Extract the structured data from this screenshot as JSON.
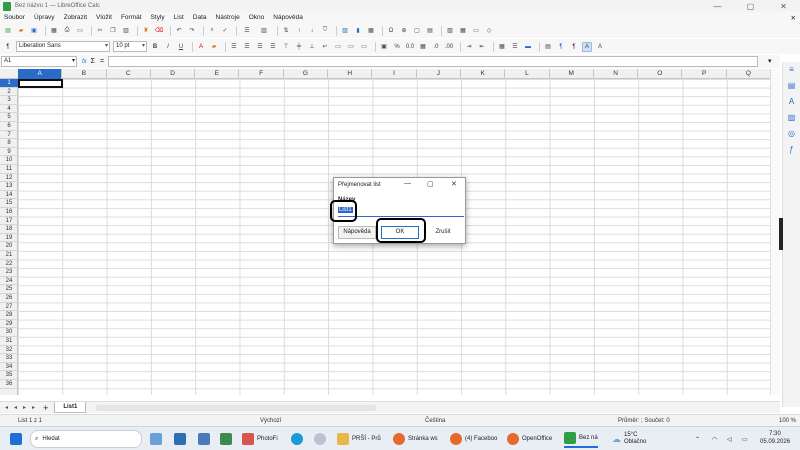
{
  "window": {
    "title": "Bez názvu 1 — LibreOffice Calc",
    "minimize": "—",
    "maximize": "▢",
    "close": "✕"
  },
  "menu": [
    "Soubor",
    "Úpravy",
    "Zobrazit",
    "Vložit",
    "Formát",
    "Styly",
    "List",
    "Data",
    "Nástroje",
    "Okno",
    "Nápověda"
  ],
  "menu_close": "✕",
  "toolbar2": {
    "font_name": "Liberation Sans",
    "font_size": "10 pt",
    "bold": "B",
    "italic": "I",
    "underline": "U",
    "percent": "%",
    "decimal": "0.0"
  },
  "formula_bar": {
    "name_box": "A1",
    "fx": "fx",
    "sigma": "Σ",
    "equals": "="
  },
  "columns": [
    "A",
    "B",
    "C",
    "D",
    "E",
    "F",
    "G",
    "H",
    "I",
    "J",
    "K",
    "L",
    "M",
    "N",
    "O",
    "P",
    "Q"
  ],
  "rows": [
    "1",
    "2",
    "3",
    "4",
    "5",
    "6",
    "7",
    "8",
    "9",
    "10",
    "11",
    "12",
    "13",
    "14",
    "15",
    "16",
    "17",
    "18",
    "19",
    "20",
    "21",
    "22",
    "23",
    "24",
    "25",
    "26",
    "27",
    "28",
    "29",
    "30",
    "31",
    "32",
    "33",
    "34",
    "35",
    "36"
  ],
  "sheet_tab": "List1",
  "status": {
    "sheet": "List 1 z 1",
    "style": "Výchozí",
    "language": "Čeština",
    "sum": "Průměr: ; Součet: 0",
    "zoom": "100 %"
  },
  "dialog": {
    "title": "Přejmenovat list",
    "name_label": "Název",
    "name_value": "List1",
    "help_button": "Nápověda",
    "ok_button": "OK",
    "cancel_button": "Zrušit"
  },
  "taskbar": {
    "search": "Hledat",
    "photofi": "PhotoFi",
    "prsi": "PRŠÍ - Prů",
    "stranka": "Stránka ws",
    "facebook": "(4) Faceboo",
    "openoffice": "OpenOffice",
    "bez": "Bez ná",
    "weather_temp": "15°C",
    "weather_desc": "Oblačno",
    "time": "7:30",
    "date": "05.09.2026"
  },
  "colors": {
    "accent": "#2a6ac8",
    "calc_green": "#2f9e44"
  }
}
